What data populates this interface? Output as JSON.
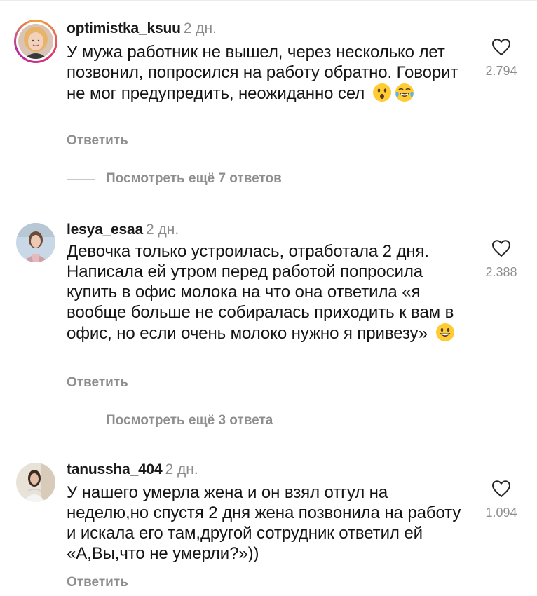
{
  "comments": [
    {
      "username": "optimistka_ksuu",
      "time": "2 дн.",
      "text": "У мужа работник не вышел, через несколько лет позвонил, попросился на работу обратно. Говорит не мог предупредить, неожиданно сел",
      "emojis": [
        "hushed-face-emoji",
        "tears-of-joy-emoji"
      ],
      "likes": "2.794",
      "reply_label": "Ответить",
      "more_replies": "Посмотреть ещё 7 ответов"
    },
    {
      "username": "lesya_esaa",
      "time": "2 дн.",
      "text": "Девочка только устроилась, отработала 2 дня. Написала ей утром перед работой попросила купить в офис молока на что она ответила «я вообще больше не собиралась приходить к вам в офис, но если очень молоко нужно я привезу»",
      "emojis": [
        "grinning-face-emoji"
      ],
      "likes": "2.388",
      "reply_label": "Ответить",
      "more_replies": "Посмотреть ещё 3 ответа"
    },
    {
      "username": "tanussha_404",
      "time": "2 дн.",
      "text": "У нашего умерла жена и он взял отгул на неделю,но спустя 2 дня жена позвонила на работу и искала его там,другой сотрудник ответил ей «А,Вы,что не умерли?»))",
      "emojis": [],
      "likes": "1.094",
      "reply_label": "Ответить"
    }
  ],
  "icons": {
    "like": "heart-outline-icon"
  },
  "colors": {
    "muted": "#8e8e8e",
    "story_ring": [
      "#f6a33b",
      "#e23c6a",
      "#b227a4"
    ]
  }
}
